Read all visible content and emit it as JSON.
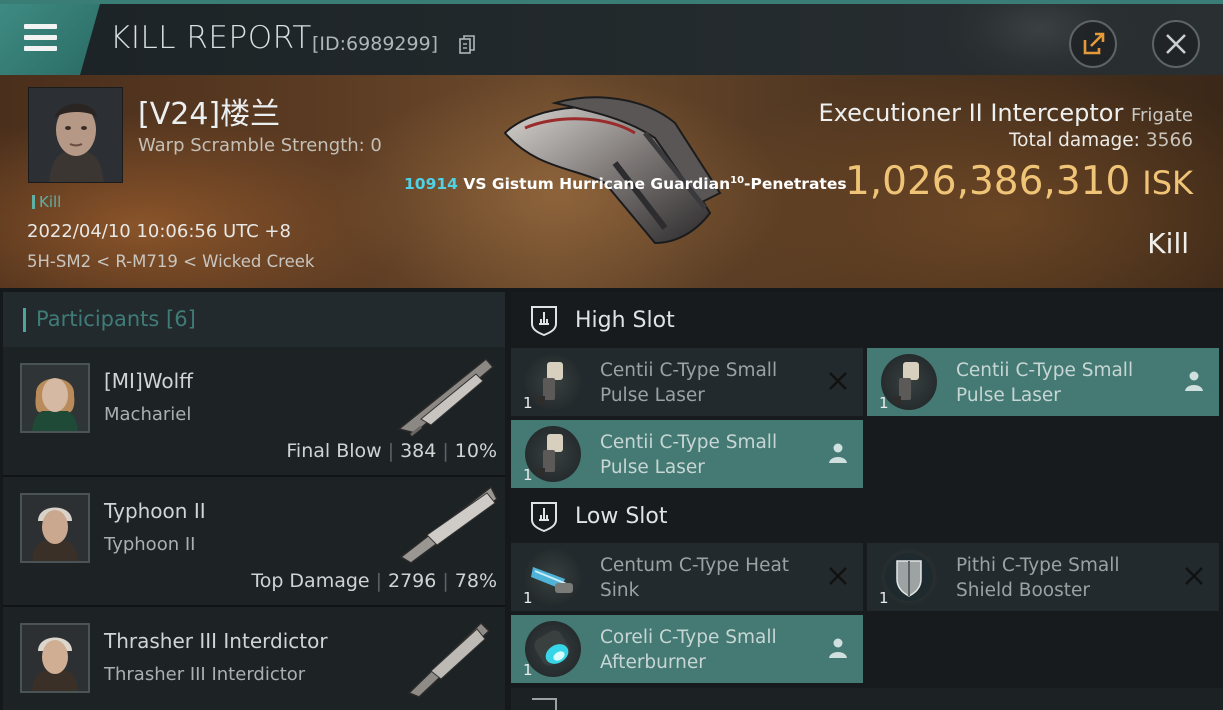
{
  "topbar": {
    "title": "KILL REPORT",
    "id_text": "[ID:6989299]"
  },
  "victim": {
    "name": "[V24]楼兰",
    "warp_scramble": "Warp Scramble Strength: 0",
    "tag": "Kill",
    "datetime": "2022/04/10 10:06:56 UTC +8",
    "location": "5H-SM2 < R-M719 < Wicked Creek",
    "ship_name": "Executioner II Interceptor",
    "ship_class": "Frigate",
    "total_damage_label": "Total damage:",
    "total_damage_value": "3566",
    "isk_value": "1,026,386,310",
    "isk_unit": "ISK",
    "result_label": "Kill"
  },
  "vs": {
    "number": "10914",
    "text": "VS Gistum Hurricane Guardian",
    "superscript": "10",
    "suffix": "-Penetrates"
  },
  "participants": {
    "header": "Participants [6]",
    "rows": [
      {
        "name": "[MI]Wolff",
        "ship": "Machariel",
        "label": "Final Blow",
        "damage": "384",
        "percent": "10%"
      },
      {
        "name": "Typhoon II",
        "ship": "Typhoon II",
        "label": "Top Damage",
        "damage": "2796",
        "percent": "78%"
      },
      {
        "name": "Thrasher III Interdictor",
        "ship": "Thrasher III Interdictor",
        "label": "",
        "damage": "",
        "percent": ""
      }
    ]
  },
  "fittings": {
    "high_slot": {
      "title": "High Slot",
      "modules": [
        {
          "name": "Centii C-Type Small Pulse Laser",
          "qty": "1",
          "status": "destroyed",
          "icon": "laser-turret-icon"
        },
        {
          "name": "Centii C-Type Small Pulse Laser",
          "qty": "1",
          "status": "dropped",
          "icon": "laser-turret-icon"
        },
        {
          "name": "Centii C-Type Small Pulse Laser",
          "qty": "1",
          "status": "dropped",
          "icon": "laser-turret-icon"
        }
      ]
    },
    "low_slot": {
      "title": "Low Slot",
      "modules": [
        {
          "name": "Centum C-Type Heat Sink",
          "qty": "1",
          "status": "destroyed",
          "icon": "heat-sink-icon"
        },
        {
          "name": "Pithi C-Type Small Shield Booster",
          "qty": "1",
          "status": "destroyed",
          "icon": "shield-booster-icon"
        },
        {
          "name": "Coreli C-Type Small Afterburner",
          "qty": "1",
          "status": "dropped",
          "icon": "afterburner-icon"
        }
      ]
    }
  },
  "colors": {
    "accent": "#447a73",
    "isk": "#f0c477",
    "vs_number": "#4fd2e6"
  }
}
